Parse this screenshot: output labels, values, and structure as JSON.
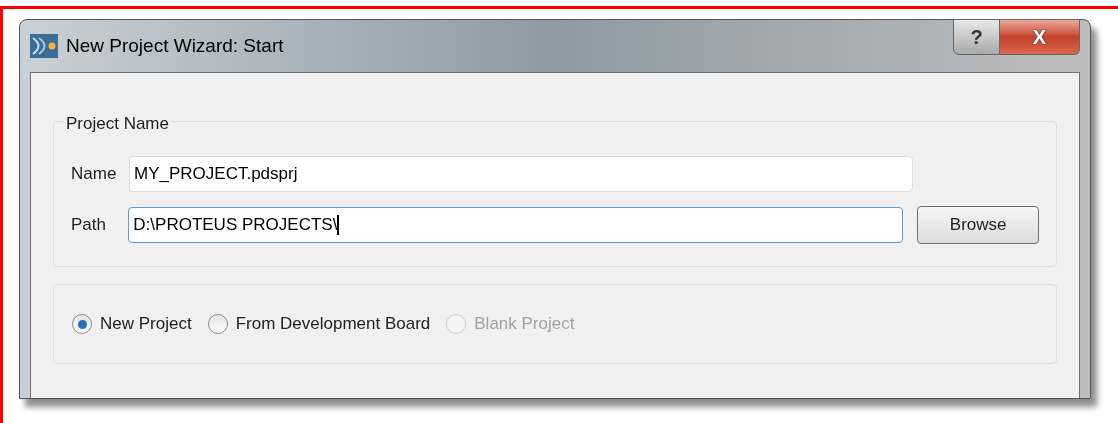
{
  "window": {
    "title": "New Project Wizard: Start",
    "buttons": [
      {
        "kind": "help",
        "label": "?"
      },
      {
        "kind": "close",
        "label": "X"
      }
    ]
  },
  "project_name": {
    "title": "Project Name",
    "fields": [
      {
        "label": "Name",
        "value": "MY_PROJECT.pdsprj",
        "focused": false
      },
      {
        "label": "Path",
        "value": "D:\\PROTEUS PROJECTS\\",
        "focused": true,
        "button": "Browse"
      }
    ]
  },
  "project_type": [
    {
      "label": "New Project",
      "selected": true,
      "disabled": false
    },
    {
      "label": "From Development Board",
      "selected": false,
      "disabled": false
    },
    {
      "label": "Blank Project",
      "selected": false,
      "disabled": true
    }
  ]
}
